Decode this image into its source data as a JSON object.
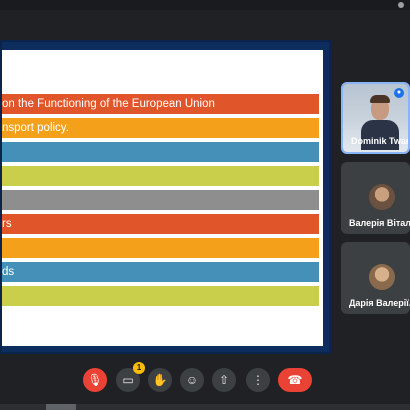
{
  "slide": {
    "bars": [
      {
        "text": "on the Functioning of the European Union",
        "color": "#e0552a"
      },
      {
        "text": "nsport policy.",
        "color": "#f5a01a"
      },
      {
        "text": "",
        "color": "#4590b8"
      },
      {
        "text": "",
        "color": "#c9cf4b"
      },
      {
        "text": "",
        "color": "#8e8e8e"
      },
      {
        "text": "rs",
        "color": "#e0552a"
      },
      {
        "text": "",
        "color": "#f5a01a"
      },
      {
        "text": "ds",
        "color": "#4590b8"
      },
      {
        "text": "",
        "color": "#c9cf4b"
      }
    ]
  },
  "participants": [
    {
      "name": "Dominik Twar...",
      "speaking": true
    },
    {
      "name": "Валерія Віталі...",
      "speaking": false
    },
    {
      "name": "Дарія Валерії...",
      "speaking": false
    }
  ],
  "controls": {
    "mic": "mic-off-icon",
    "camera": "camera-off-icon",
    "camera_badge": "1",
    "raise_hand": "hand-icon",
    "reactions": "emoji-icon",
    "present": "present-icon",
    "more": "more-icon",
    "end_call": "phone-hangup-icon"
  }
}
